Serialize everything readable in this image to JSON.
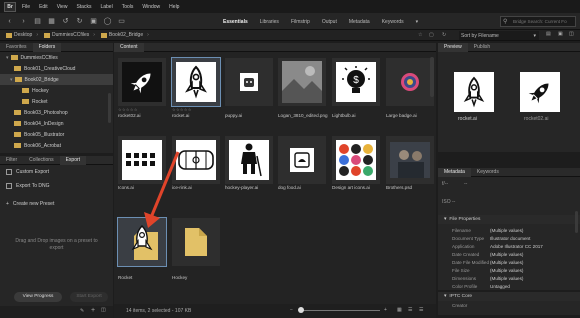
{
  "menu": [
    "File",
    "Edit",
    "View",
    "Stacks",
    "Label",
    "Tools",
    "Window",
    "Help"
  ],
  "logo": "Br",
  "workspaces": {
    "items": [
      "Essentials",
      "Libraries",
      "Filmstrip",
      "Output",
      "Metadata",
      "Keywords"
    ],
    "active": "Essentials"
  },
  "search": {
    "placeholder": "Bridge Search: Current Fo"
  },
  "pathbar": {
    "crumbs": [
      "Desktop",
      "DummiesCCfiles",
      "Book02_Bridge"
    ],
    "sort_label": "Sort by Filename"
  },
  "left": {
    "tabs": [
      "Favorites",
      "Folders"
    ],
    "active": "Folders",
    "folders": [
      {
        "name": "DummiesCCfiles",
        "level": 0
      },
      {
        "name": "Book01_CreativeCloud",
        "level": 1
      },
      {
        "name": "Book02_Bridge",
        "level": 1,
        "selected": true
      },
      {
        "name": "Hockey",
        "level": 2
      },
      {
        "name": "Rocket",
        "level": 2
      },
      {
        "name": "Book03_Photoshop",
        "level": 1
      },
      {
        "name": "Book04_InDesign",
        "level": 1
      },
      {
        "name": "Book05_Illustrator",
        "level": 1
      },
      {
        "name": "Book06_Acrobat",
        "level": 1
      }
    ]
  },
  "lower_left": {
    "tabs": [
      "Filter",
      "Collections",
      "Export"
    ],
    "active": "Export",
    "items": [
      "Custom Export",
      "Export To DNG"
    ],
    "create_preset": "Create new Preset",
    "hint": "Drag and Drop images on a preset to export",
    "view_progress": "View Progress",
    "start_export": "Start Export"
  },
  "content": {
    "tab": "Content",
    "items": [
      {
        "name": "rocket02.ai",
        "stars": "☆☆☆☆☆"
      },
      {
        "name": "rocket.ai",
        "stars": "☆☆☆☆☆"
      },
      {
        "name": "puppy.ai"
      },
      {
        "name": "Logan_3810_edited.png"
      },
      {
        "name": "Lightbulb.ai"
      },
      {
        "name": "Large badge.ai"
      },
      {
        "name": "Icons.ai"
      },
      {
        "name": "ice-rink.ai"
      },
      {
        "name": "hockey-player.ai"
      },
      {
        "name": "dog food.ai"
      },
      {
        "name": "Design art icons.ai"
      },
      {
        "name": "Brothers.psd"
      },
      {
        "name": "Rocket"
      },
      {
        "name": "Hockey"
      }
    ],
    "status": "14 items, 2 selected - 107 KB"
  },
  "right": {
    "tabs": [
      "Preview",
      "Publish"
    ],
    "active": "Preview",
    "preview_labels": [
      "rocket.ai",
      "rocket02.ai"
    ],
    "meta_tabs": [
      "Metadata",
      "Keywords"
    ],
    "exposure": [
      "f/--",
      "--",
      "ISO --"
    ],
    "file_props_title": "File Properties",
    "props": [
      {
        "k": "Filename",
        "v": "(Multiple values)"
      },
      {
        "k": "Document Type",
        "v": "Illustrator document"
      },
      {
        "k": "Application",
        "v": "Adobe Illustrator CC 2017"
      },
      {
        "k": "Date Created",
        "v": "(Multiple values)"
      },
      {
        "k": "Date File Modified",
        "v": "(Multiple values)"
      },
      {
        "k": "File Size",
        "v": "(Multiple values)"
      },
      {
        "k": "Dimensions",
        "v": "(Multiple values)"
      },
      {
        "k": "Color Profile",
        "v": "Untagged"
      }
    ],
    "iptc_title": "IPTC Core",
    "creator": "Creator"
  },
  "colors": {
    "accent": "#e0442a",
    "folder": "#cfa84c",
    "selection": "#6c8fb3"
  }
}
